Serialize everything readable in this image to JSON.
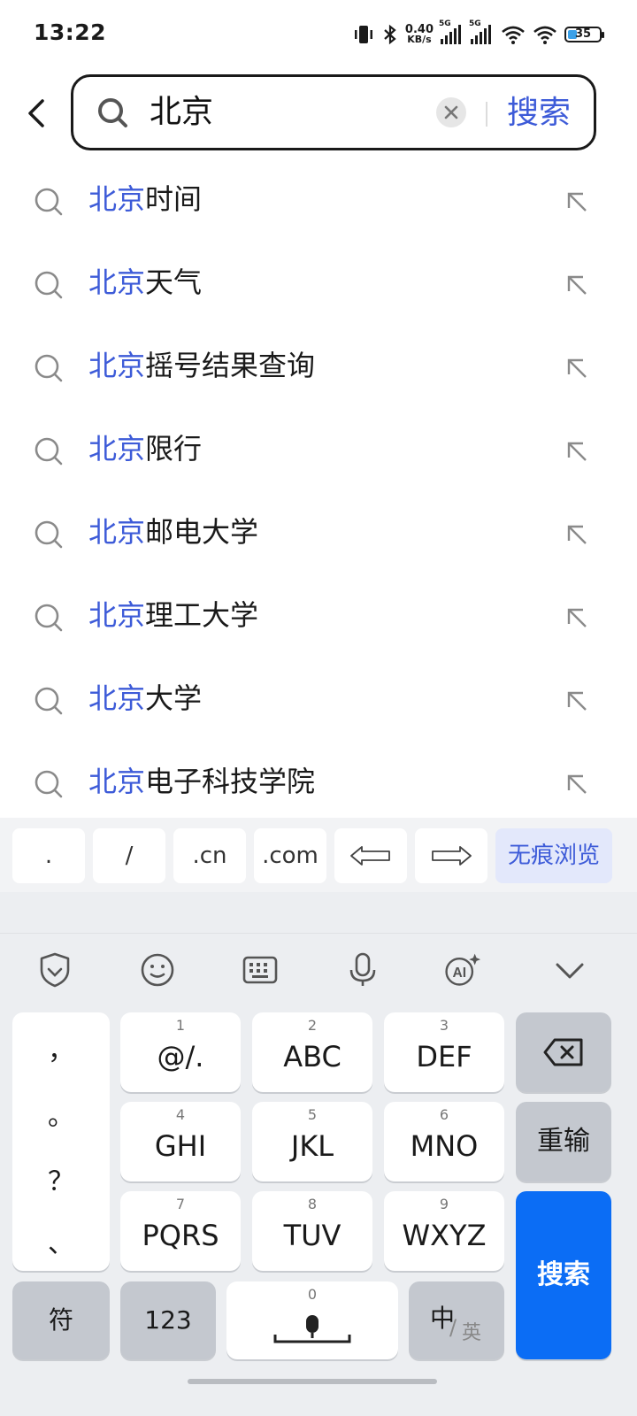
{
  "status_bar": {
    "time": "13:22",
    "net_speed_value": "0.40",
    "net_speed_unit": "KB/s",
    "sim1": "5G",
    "sim2": "5G",
    "battery": "35"
  },
  "search": {
    "query": "北京",
    "submit_label": "搜索"
  },
  "suggestions": [
    {
      "highlight": "北京",
      "rest": "时间"
    },
    {
      "highlight": "北京",
      "rest": "天气"
    },
    {
      "highlight": "北京",
      "rest": "摇号结果查询"
    },
    {
      "highlight": "北京",
      "rest": "限行"
    },
    {
      "highlight": "北京",
      "rest": "邮电大学"
    },
    {
      "highlight": "北京",
      "rest": "理工大学"
    },
    {
      "highlight": "北京",
      "rest": "大学"
    },
    {
      "highlight": "北京",
      "rest": "电子科技学院"
    }
  ],
  "quick_keys": {
    "dot": ".",
    "slash": "/",
    "cn": ".cn",
    "com": ".com",
    "incognito": "无痕浏览"
  },
  "keyboard": {
    "punctuation": [
      "，",
      "。",
      "？",
      "、"
    ],
    "keys": [
      {
        "num": "1",
        "label": "@/."
      },
      {
        "num": "2",
        "label": "ABC"
      },
      {
        "num": "3",
        "label": "DEF"
      },
      {
        "num": "4",
        "label": "GHI"
      },
      {
        "num": "5",
        "label": "JKL"
      },
      {
        "num": "6",
        "label": "MNO"
      },
      {
        "num": "7",
        "label": "PQRS"
      },
      {
        "num": "8",
        "label": "TUV"
      },
      {
        "num": "9",
        "label": "WXYZ"
      }
    ],
    "retype": "重输",
    "search": "搜索",
    "symbols": "符",
    "numbers": "123",
    "space_num": "0",
    "lang_main": "中",
    "lang_alt": "英"
  },
  "colors": {
    "accent": "#3d5bd8",
    "keyboard_search": "#0b6df5",
    "keyboard_bg": "#eceef1"
  }
}
